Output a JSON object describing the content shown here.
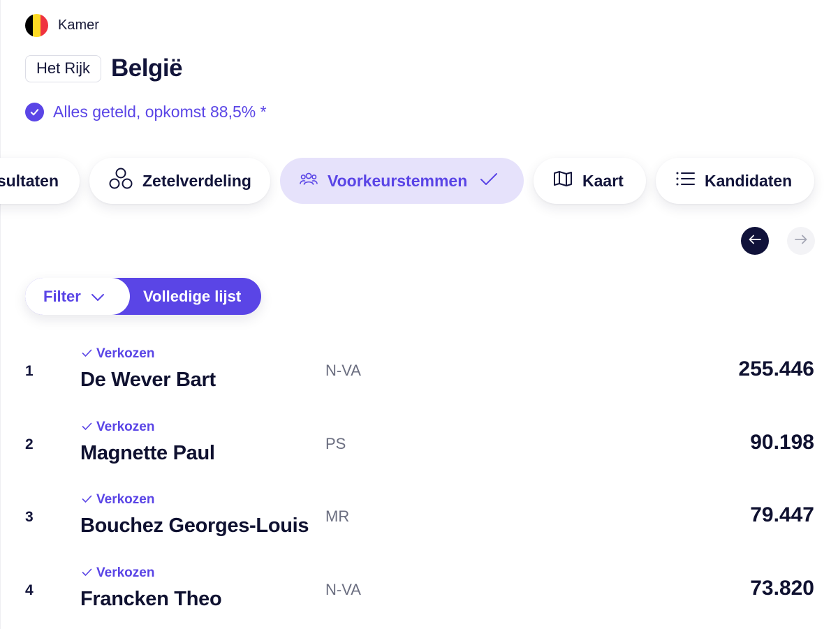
{
  "header": {
    "chamber": "Kamer",
    "flag_colors": [
      "#000000",
      "#FDDA24",
      "#EF3340"
    ],
    "region_chip": "Het Rijk",
    "region_title": "België",
    "status": "Alles geteld, opkomst 88,5% *"
  },
  "tabs": [
    {
      "label": "sultaten",
      "icon": "none",
      "active": false
    },
    {
      "label": "Zetelverdeling",
      "icon": "circles-icon",
      "active": false
    },
    {
      "label": "Voorkeurstemmen",
      "icon": "people-icon",
      "active": true
    },
    {
      "label": "Kaart",
      "icon": "map-icon",
      "active": false
    },
    {
      "label": "Kandidaten",
      "icon": "list-icon",
      "active": false
    }
  ],
  "filter": {
    "filter_label": "Filter",
    "full_list_label": "Volledige lijst"
  },
  "candidates": [
    {
      "rank": "1",
      "status": "Verkozen",
      "name": "De Wever Bart",
      "party": "N-VA",
      "votes": "255.446"
    },
    {
      "rank": "2",
      "status": "Verkozen",
      "name": "Magnette Paul",
      "party": "PS",
      "votes": "90.198"
    },
    {
      "rank": "3",
      "status": "Verkozen",
      "name": "Bouchez Georges-Louis",
      "party": "MR",
      "votes": "79.447"
    },
    {
      "rank": "4",
      "status": "Verkozen",
      "name": "Francken Theo",
      "party": "N-VA",
      "votes": "73.820"
    }
  ],
  "colors": {
    "accent": "#5A45E6",
    "dark": "#10123A",
    "active_tab_bg": "#E6E2FB"
  }
}
